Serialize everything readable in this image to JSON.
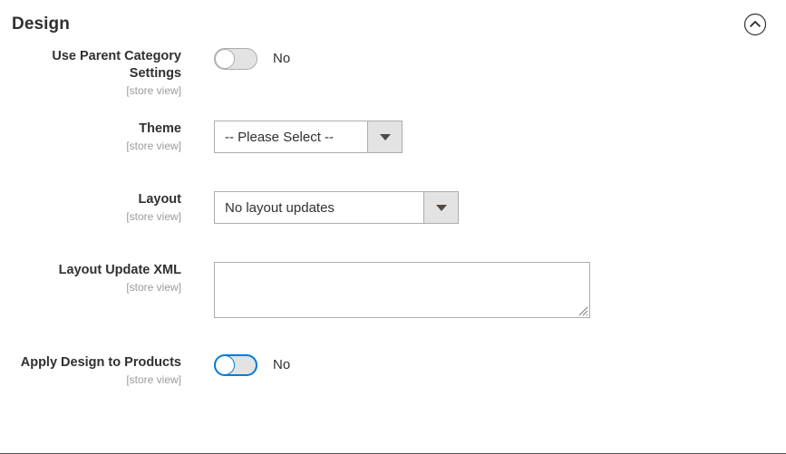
{
  "section": {
    "title": "Design",
    "collapse_icon": "chevron-up-circle-icon",
    "collapsed": false
  },
  "colors": {
    "text": "#303030",
    "scope_text": "#9b9b9b",
    "border": "#adadad",
    "focus_blue": "#007bdb",
    "control_fill": "#e3e3e3",
    "section_rule": "#4e4e4e"
  },
  "fields": [
    {
      "id": "use-parent-category-settings",
      "label": "Use Parent Category Settings",
      "scope": "[store view]",
      "type": "toggle",
      "value": "No",
      "checked": false,
      "focused": false
    },
    {
      "id": "theme",
      "label": "Theme",
      "scope": "[store view]",
      "type": "select",
      "value": "-- Please Select --",
      "options": [
        "-- Please Select --"
      ]
    },
    {
      "id": "layout",
      "label": "Layout",
      "scope": "[store view]",
      "type": "select",
      "value": "No layout updates",
      "options": [
        "No layout updates"
      ]
    },
    {
      "id": "layout-update-xml",
      "label": "Layout Update XML",
      "scope": "[store view]",
      "type": "textarea",
      "value": "",
      "placeholder": ""
    },
    {
      "id": "apply-design-to-products",
      "label": "Apply Design to Products",
      "scope": "[store view]",
      "type": "toggle",
      "value": "No",
      "checked": false,
      "focused": true
    }
  ]
}
